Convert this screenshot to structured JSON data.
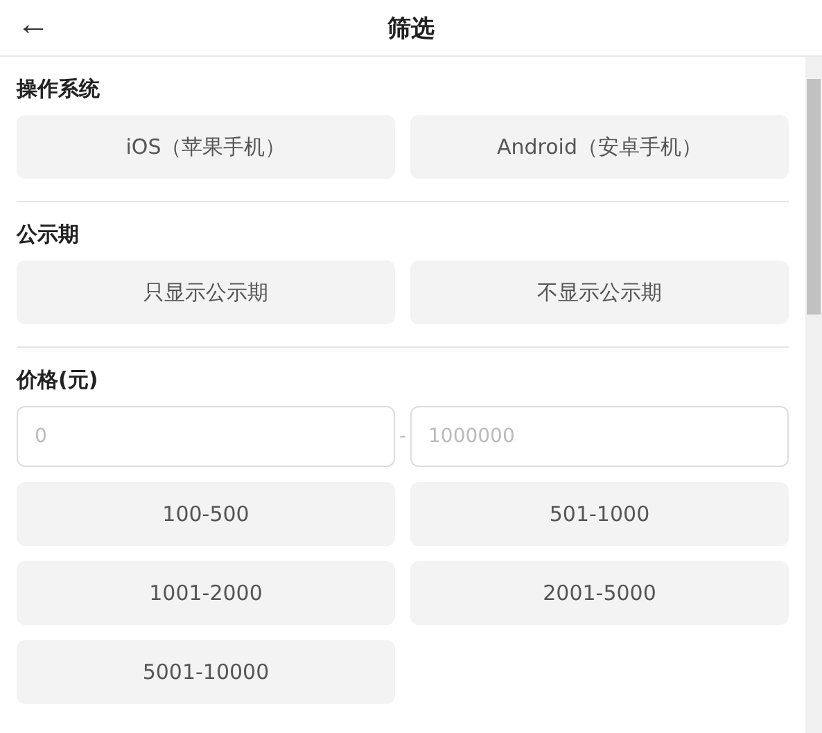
{
  "header": {
    "back": "←",
    "title": "筛选"
  },
  "sections": [
    {
      "kind": "options",
      "title": "操作系统",
      "options": [
        "iOS（苹果手机）",
        "Android（安卓手机）"
      ]
    },
    {
      "kind": "options",
      "title": "公示期",
      "options": [
        "只显示公示期",
        "不显示公示期"
      ]
    },
    {
      "kind": "price",
      "title": "价格(元)",
      "min_placeholder": "0",
      "separator": "-",
      "max_placeholder": "1000000",
      "options": [
        "100-500",
        "501-1000",
        "1001-2000",
        "2001-5000",
        "5001-10000"
      ]
    }
  ]
}
